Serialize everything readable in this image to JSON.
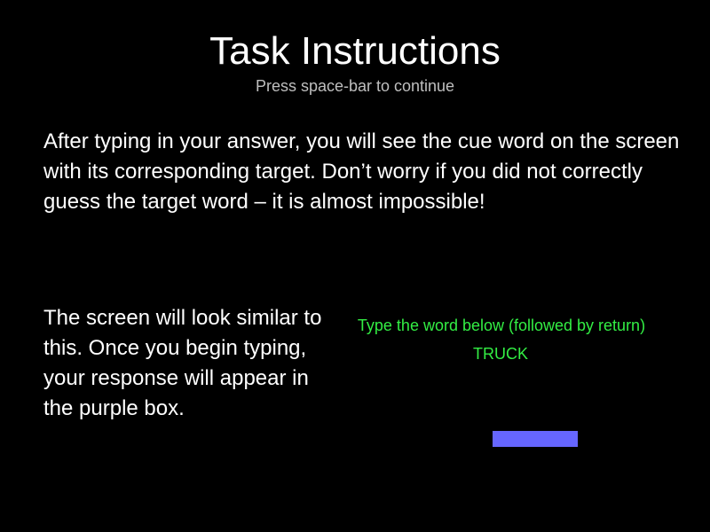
{
  "title": "Task Instructions",
  "subtitle": "Press space-bar to continue",
  "paragraph_1": "After typing in your answer, you will see the cue word on the screen with its corresponding target. Don’t worry if you did not correctly guess the target word – it is almost impossible!",
  "paragraph_2": "The screen will look similar to this. Once you begin typing, your response will appear in the purple box.",
  "preview": {
    "instruction": "Type the word below (followed by return)",
    "cue_word": "TRUCK",
    "response_text": ""
  },
  "colors": {
    "background": "#000000",
    "text": "#ffffff",
    "subtitle": "#bfbfbf",
    "preview_text": "#33ee44",
    "response_box": "#6666ff"
  }
}
